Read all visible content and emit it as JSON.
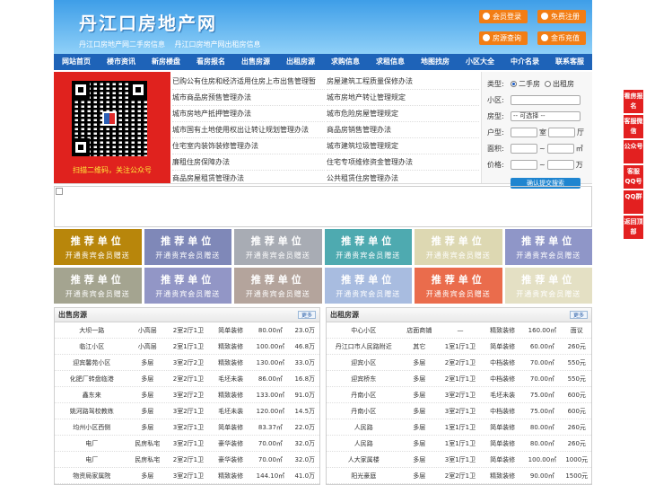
{
  "header": {
    "title": "丹江口房地产网",
    "subtitle_links": [
      "丹江口房地产网二手房信息",
      "丹江口房地产网出租房信息"
    ],
    "buttons": [
      "会员登录",
      "免费注册",
      "房源查询",
      "金币充值"
    ]
  },
  "nav": [
    "网站首页",
    "楼市资讯",
    "新房楼盘",
    "看房报名",
    "出售房源",
    "出租房源",
    "求购信息",
    "求租信息",
    "地图找房",
    "小区大全",
    "中介名录",
    "联系客服"
  ],
  "qr": {
    "caption": "扫描二维码，关注公众号"
  },
  "notices": {
    "left": [
      "已购公有住房和经济适用住房上市出售管理暂",
      "城市商品房预售管理办法",
      "城市房地产抵押管理办法",
      "城市国有土地使用权出让转让规划管理办法",
      "住宅室内装饰装修管理办法",
      "廉租住房保障办法",
      "商品房屋租赁管理办法"
    ],
    "right": [
      "房屋建筑工程质量保修办法",
      "城市房地产转让管理规定",
      "城市危险房屋管理规定",
      "商品房销售管理办法",
      "城市建筑垃圾管理规定",
      "住宅专项维修资金管理办法",
      "公共租赁住房管理办法"
    ]
  },
  "search": {
    "type_label": "类型:",
    "type_options": [
      "二手房",
      "出租房"
    ],
    "community_label": "小区:",
    "room_label": "房型:",
    "room_select": "-- 可选择 --",
    "layout_label": "户型:",
    "layout_unit1": "室",
    "layout_unit2": "厅",
    "area_label": "面积:",
    "area_unit": "㎡",
    "price_label": "价格:",
    "price_unit": "万",
    "range_sep": "~",
    "submit": "确认提交搜索"
  },
  "ads": {
    "line1": "推荐单位",
    "line2": "开通贵宾会员赠送",
    "colors": [
      "#b8860b",
      "#7f88b8",
      "#a8acb4",
      "#4eaab0",
      "#ddd8b2",
      "#8f96c8",
      "#a4a490",
      "#9296c6",
      "#b4a49c",
      "#a8bce0",
      "#ea6c4c",
      "#e4e0c4"
    ]
  },
  "sale": {
    "title": "出售房源",
    "more": "更多",
    "rows": [
      [
        "大坝一路",
        "小高层",
        "2室2厅1卫",
        "简单装修",
        "80.00㎡",
        "23.0万"
      ],
      [
        "临江小区",
        "小高层",
        "2室1厅1卫",
        "精致装修",
        "100.00㎡",
        "46.8万"
      ],
      [
        "迎宾馨苑小区",
        "多层",
        "3室2厅2卫",
        "精致装修",
        "130.00㎡",
        "33.0万"
      ],
      [
        "化肥厂转盘临港",
        "多层",
        "2室2厅1卫",
        "毛坯未装",
        "86.00㎡",
        "16.8万"
      ],
      [
        "鑫东来",
        "多层",
        "3室2厅2卫",
        "精致装修",
        "133.00㎡",
        "91.0万"
      ],
      [
        "姚河路驾校教练",
        "多层",
        "3室2厅1卫",
        "毛坯未装",
        "120.00㎡",
        "14.5万"
      ],
      [
        "均州小区西侧",
        "多层",
        "3室2厅1卫",
        "简单装修",
        "83.37㎡",
        "22.0万"
      ],
      [
        "电厂",
        "民房私宅",
        "3室2厅1卫",
        "豪华装修",
        "70.00㎡",
        "32.0万"
      ],
      [
        "电厂",
        "民房私宅",
        "2室2厅1卫",
        "豪华装修",
        "70.00㎡",
        "32.0万"
      ],
      [
        "物资局家属院",
        "多层",
        "3室2厅1卫",
        "精致装修",
        "144.10㎡",
        "41.0万"
      ]
    ]
  },
  "rent": {
    "title": "出租房源",
    "more": "更多",
    "rows": [
      [
        "中心小区",
        "店面商铺",
        "—",
        "精致装修",
        "160.00㎡",
        "面议"
      ],
      [
        "丹江口市人民路附近",
        "其它",
        "1室1厅1卫",
        "简单装修",
        "60.00㎡",
        "260元"
      ],
      [
        "迎宾小区",
        "多层",
        "2室2厅1卫",
        "中档装修",
        "70.00㎡",
        "550元"
      ],
      [
        "迎宾桥东",
        "多层",
        "2室1厅1卫",
        "中档装修",
        "70.00㎡",
        "550元"
      ],
      [
        "丹南小区",
        "多层",
        "3室2厅1卫",
        "毛坯未装",
        "75.00㎡",
        "600元"
      ],
      [
        "丹南小区",
        "多层",
        "3室2厅1卫",
        "中档装修",
        "75.00㎡",
        "600元"
      ],
      [
        "人民路",
        "多层",
        "1室1厅1卫",
        "简单装修",
        "80.00㎡",
        "260元"
      ],
      [
        "人民路",
        "多层",
        "1室1厅1卫",
        "简单装修",
        "80.00㎡",
        "260元"
      ],
      [
        "人大家属楼",
        "多层",
        "3室1厅1卫",
        "简单装修",
        "100.00㎡",
        "1000元"
      ],
      [
        "阳光豪庭",
        "多层",
        "2室2厅1卫",
        "精致装修",
        "90.00㎡",
        "1500元"
      ]
    ]
  },
  "side": [
    "看房报名",
    "客服微信",
    "公众号",
    "客服QQ号",
    "QQ群",
    "返回顶部"
  ]
}
